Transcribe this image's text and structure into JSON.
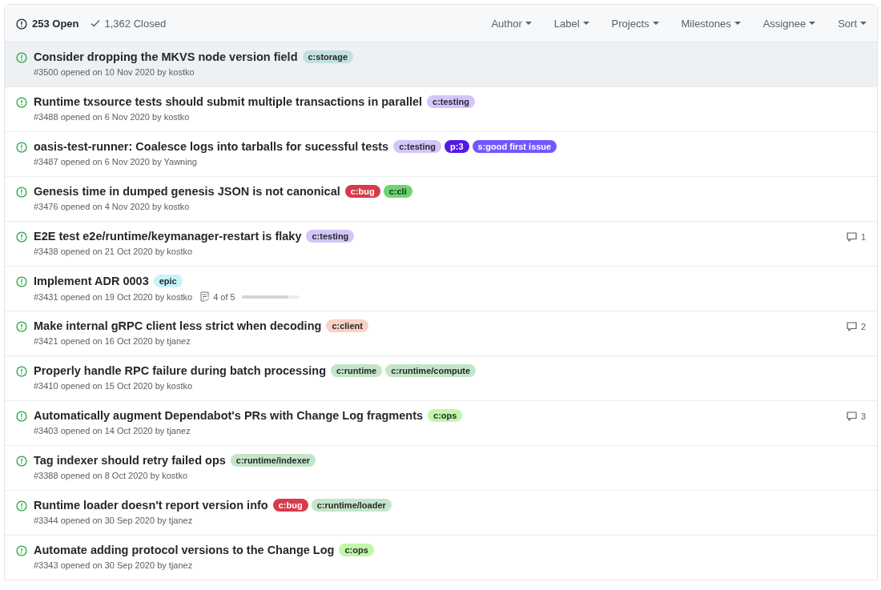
{
  "header": {
    "open_count": "253 Open",
    "closed_count": "1,362 Closed",
    "filters": [
      "Author",
      "Label",
      "Projects",
      "Milestones",
      "Assignee",
      "Sort"
    ]
  },
  "issues": [
    {
      "title": "Consider dropping the MKVS node version field",
      "meta": "#3500 opened on 10 Nov 2020 by kostko",
      "selected": true,
      "labels": [
        {
          "text": "c:storage",
          "color": "#c2e0de"
        }
      ]
    },
    {
      "title": "Runtime txsource tests should submit multiple transactions in parallel",
      "meta": "#3488 opened on 6 Nov 2020 by kostko",
      "selected": false,
      "labels": [
        {
          "text": "c:testing",
          "color": "#d4c5f9"
        }
      ]
    },
    {
      "title": "oasis-test-runner: Coalesce logs into tarballs for sucessful tests",
      "meta": "#3487 opened on 6 Nov 2020 by Yawning",
      "selected": false,
      "labels": [
        {
          "text": "c:testing",
          "color": "#d4c5f9"
        },
        {
          "text": "p:3",
          "color": "#5319e7"
        },
        {
          "text": "s:good first issue",
          "color": "#7057ff"
        }
      ]
    },
    {
      "title": "Genesis time in dumped genesis JSON is not canonical",
      "meta": "#3476 opened on 4 Nov 2020 by kostko",
      "selected": false,
      "labels": [
        {
          "text": "c:bug",
          "color": "#d73a4a"
        },
        {
          "text": "c:cli",
          "color": "#6bd66b"
        }
      ]
    },
    {
      "title": "E2E test e2e/runtime/keymanager-restart is flaky",
      "meta": "#3438 opened on 21 Oct 2020 by kostko",
      "selected": false,
      "labels": [
        {
          "text": "c:testing",
          "color": "#d4c5f9"
        }
      ],
      "comments": "1"
    },
    {
      "title": "Implement ADR 0003",
      "meta": "#3431 opened on 19 Oct 2020 by kostko",
      "selected": false,
      "labels": [
        {
          "text": "epic",
          "color": "#c9f3fb"
        }
      ],
      "tasks": {
        "text": "4 of 5",
        "level": 0.8
      }
    },
    {
      "title": "Make internal gRPC client less strict when decoding",
      "meta": "#3421 opened on 16 Oct 2020 by tjanez",
      "selected": false,
      "labels": [
        {
          "text": "c:client",
          "color": "#f9d0c4"
        }
      ],
      "comments": "2"
    },
    {
      "title": "Properly handle RPC failure during batch processing",
      "meta": "#3410 opened on 15 Oct 2020 by kostko",
      "selected": false,
      "labels": [
        {
          "text": "c:runtime",
          "color": "#c5e5c9"
        },
        {
          "text": "c:runtime/compute",
          "color": "#c5e5c9"
        }
      ]
    },
    {
      "title": "Automatically augment Dependabot's PRs with Change Log fragments",
      "meta": "#3403 opened on 14 Oct 2020 by tjanez",
      "selected": false,
      "labels": [
        {
          "text": "c:ops",
          "color": "#c2f7a9"
        }
      ],
      "comments": "3"
    },
    {
      "title": "Tag indexer should retry failed ops",
      "meta": "#3388 opened on 8 Oct 2020 by kostko",
      "selected": false,
      "labels": [
        {
          "text": "c:runtime/indexer",
          "color": "#c5e5c9"
        }
      ]
    },
    {
      "title": "Runtime loader doesn't report version info",
      "meta": "#3344 opened on 30 Sep 2020 by tjanez",
      "selected": false,
      "labels": [
        {
          "text": "c:bug",
          "color": "#d73a4a"
        },
        {
          "text": "c:runtime/loader",
          "color": "#c5e5c9"
        }
      ]
    },
    {
      "title": "Automate adding protocol versions to the Change Log",
      "meta": "#3343 opened on 30 Sep 2020 by tjanez",
      "selected": false,
      "labels": [
        {
          "text": "c:ops",
          "color": "#c2f7a9"
        }
      ]
    }
  ]
}
